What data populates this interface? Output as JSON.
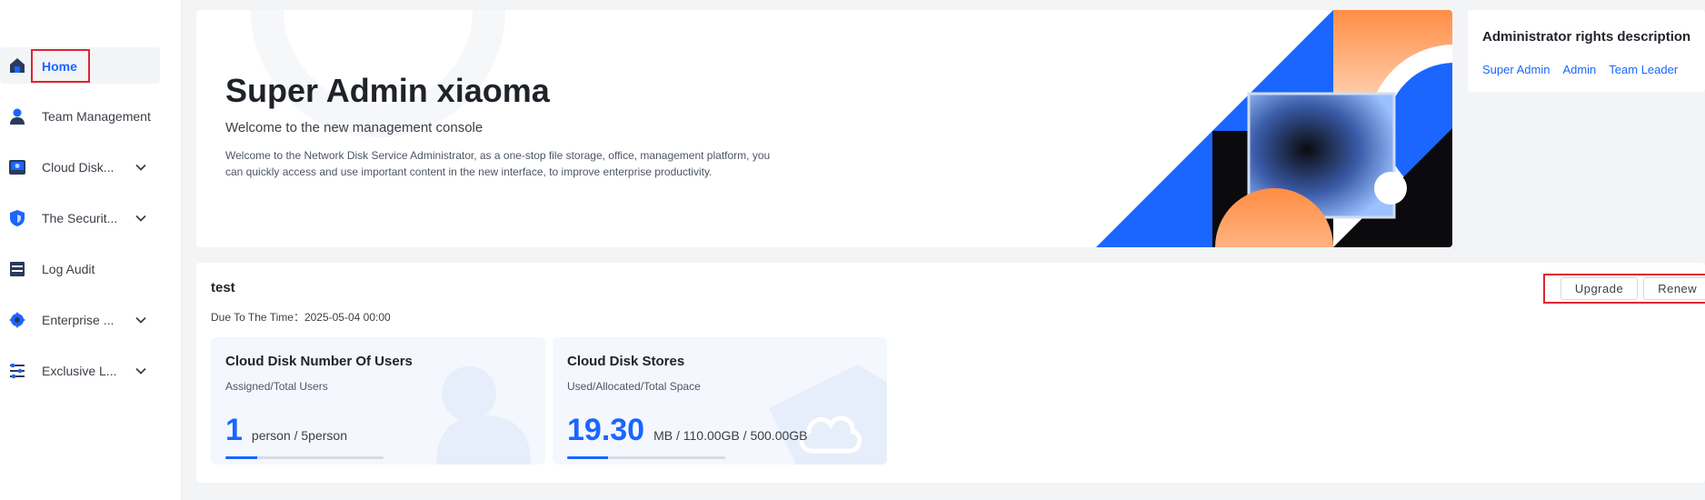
{
  "sidebar": {
    "items": [
      {
        "label": "Home",
        "icon": "home-icon",
        "active": true
      },
      {
        "label": "Team Management",
        "icon": "user-icon"
      },
      {
        "label": "Cloud Disk...",
        "icon": "cloud-disk-icon",
        "expandable": true
      },
      {
        "label": "The Securit...",
        "icon": "shield-icon",
        "expandable": true
      },
      {
        "label": "Log Audit",
        "icon": "log-icon"
      },
      {
        "label": "Enterprise ...",
        "icon": "gear-icon",
        "expandable": true
      },
      {
        "label": "Exclusive L...",
        "icon": "sliders-icon",
        "expandable": true
      }
    ]
  },
  "hero": {
    "title": "Super Admin xiaoma",
    "subtitle": "Welcome to the new management console",
    "description": "Welcome to the Network Disk Service Administrator, as a one-stop file storage, office, management platform, you can quickly access and use important content in the new interface, to improve enterprise productivity."
  },
  "rights": {
    "title": "Administrator rights description",
    "links": [
      "Super Admin",
      "Admin",
      "Team Leader"
    ]
  },
  "team": {
    "name": "test",
    "due_label": "Due To The Time：2025-05-04 00:00",
    "upgrade_label": "Upgrade",
    "renew_label": "Renew",
    "users_card": {
      "title": "Cloud Disk Number Of Users",
      "subtitle": "Assigned/Total Users",
      "value": "1",
      "unit": "person / 5person",
      "progress": 0.2
    },
    "storage_card": {
      "title": "Cloud Disk Stores",
      "subtitle": "Used/Allocated/Total Space",
      "value": "19.30",
      "unit": "MB / 110.00GB / 500.00GB",
      "progress": 0.26
    }
  },
  "colors": {
    "accent": "#1a66ff",
    "highlight_border": "#e0242f",
    "art_orange": "#ff8d45",
    "art_black": "#0b0b0d"
  }
}
